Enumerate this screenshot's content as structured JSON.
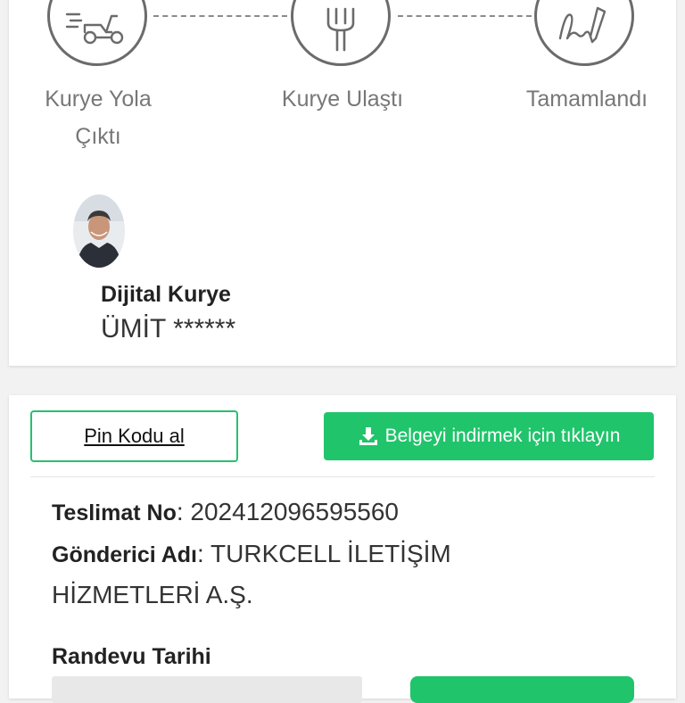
{
  "tracker": {
    "steps": [
      {
        "label": "Kurye Yola Çıktı",
        "label_line1": "Kurye Yola",
        "label_line2": "Çıktı",
        "icon": "scooter-icon"
      },
      {
        "label": "Kurye Ulaştı",
        "icon": "fork-icon"
      },
      {
        "label": "Tamamlandı",
        "icon": "signature-icon"
      }
    ]
  },
  "courier": {
    "title": "Dijital Kurye",
    "name": "ÜMİT ******"
  },
  "actions": {
    "pin_label": "Pin Kodu al",
    "download_label": "Belgeyi indirmek için tıklayın",
    "download_icon": "download-icon"
  },
  "delivery": {
    "no_label": "Teslimat No",
    "no_value": "202412096595560",
    "sender_label": "Gönderici Adı",
    "sender_value_line1": "TURKCELL İLETİŞİM",
    "sender_value_line2": "HİZMETLERİ A.Ş.",
    "appointment_label": "Randevu Tarihi"
  },
  "colors": {
    "accent": "#20c46b",
    "step_stroke": "#6b6b6b"
  }
}
